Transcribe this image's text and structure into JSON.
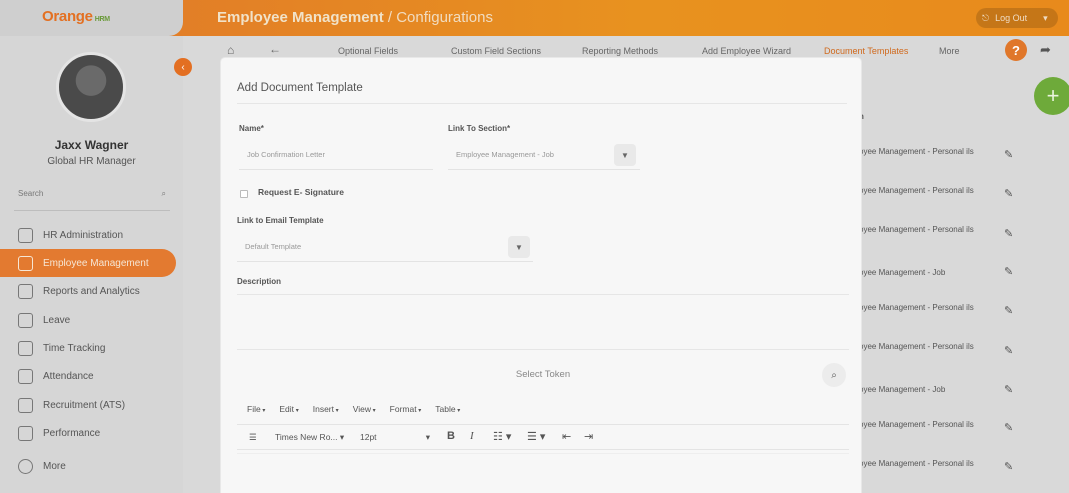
{
  "header": {
    "logo_text": "Orange",
    "logo_suffix": "HRM",
    "title_main": "Employee Management",
    "title_sub": "/ Configurations",
    "logout_label": "Log Out"
  },
  "user": {
    "name": "Jaxx Wagner",
    "role": "Global HR Manager"
  },
  "sidebar": {
    "search_placeholder": "Search",
    "items": [
      {
        "label": "HR Administration"
      },
      {
        "label": "Employee Management"
      },
      {
        "label": "Reports and Analytics"
      },
      {
        "label": "Leave"
      },
      {
        "label": "Time Tracking"
      },
      {
        "label": "Attendance"
      },
      {
        "label": "Recruitment (ATS)"
      },
      {
        "label": "Performance"
      },
      {
        "label": "More"
      }
    ]
  },
  "subnav": {
    "items": [
      "Optional Fields",
      "Custom Field Sections",
      "Reporting Methods",
      "Add Employee Wizard",
      "Document Templates",
      "More"
    ]
  },
  "background_table": {
    "column_header": "n",
    "rows": [
      "oyee Management - Personal ils",
      "oyee Management - Personal ils",
      "oyee Management - Personal ils",
      "oyee Management - Job",
      "oyee Management - Personal ils",
      "oyee Management - Personal ils",
      "oyee Management - Job",
      "oyee Management - Personal ils",
      "oyee Management - Personal ils"
    ]
  },
  "modal": {
    "title": "Add Document Template",
    "name_label": "Name*",
    "name_value": "Job Confirmation Letter",
    "section_label": "Link To Section*",
    "section_value": "Employee Management - Job",
    "esign_label": "Request E- Signature",
    "email_label": "Link to Email Template",
    "email_value": "Default Template",
    "description_label": "Description",
    "token_placeholder": "Select Token",
    "menus": [
      "File",
      "Edit",
      "Insert",
      "View",
      "Format",
      "Table"
    ],
    "font_family": "Times New Ro...",
    "font_size": "12pt"
  },
  "colors": {
    "accent": "#e37022",
    "green": "#6eaa3a"
  }
}
